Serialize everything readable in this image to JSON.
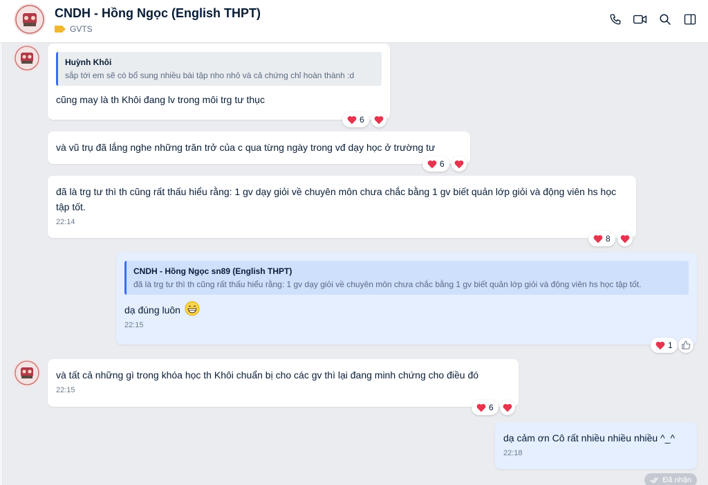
{
  "header": {
    "title": "CNDH - Hồng Ngọc (English THPT)",
    "tag": "GVTS",
    "tag_color": "#f0b72f",
    "actions": [
      "phone-icon",
      "video-icon",
      "search-icon",
      "sidebar-toggle-icon"
    ]
  },
  "messages": [
    {
      "quote": {
        "name": "Huỳnh Khôi",
        "text": "sắp tới em sẽ có bổ sung nhiều bài tập nho nhỏ và cả chứng chỉ hoàn thành :d"
      },
      "text": "cũng may là th Khôi đang lv trong môi trg tư thục",
      "reaction_count": "6"
    },
    {
      "text": "và vũ trụ đã lắng nghe những trăn trở của c qua từng ngày trong vđ dạy học ở trường tư",
      "reaction_count": "6"
    },
    {
      "text": "đã là trg tư thì th cũng rất thấu hiểu rằng: 1 gv dạy giỏi về chuyên môn chưa chắc bằng 1 gv biết quản lớp giỏi và động viên hs học tập tốt.",
      "time": "22:14",
      "reaction_count": "8"
    },
    {
      "quote": {
        "name": "CNDH - Hồng Ngọc sn89 (English THPT)",
        "text": "đã là trg tư thì th cũng rất thấu hiểu rằng: 1 gv dạy giỏi về chuyên môn chưa chắc bằng 1 gv biết quản lớp giỏi và động viên hs học tập tốt."
      },
      "text": "dạ đúng luôn",
      "time": "22:15",
      "reaction_count": "1"
    },
    {
      "text": "và tất cả những gì trong khóa học th Khôi chuẩn bị cho các gv thì lại đang minh chứng cho điều đó",
      "time": "22:15",
      "reaction_count": "6"
    },
    {
      "text": "dạ cảm ơn Cô rất nhiều nhiều nhiều ^_^",
      "time": "22:18"
    }
  ],
  "status": "Đã nhận",
  "colors": {
    "heart": "#e8344e",
    "accent": "#3b6cf7",
    "mine_bubble": "#e5efff"
  }
}
